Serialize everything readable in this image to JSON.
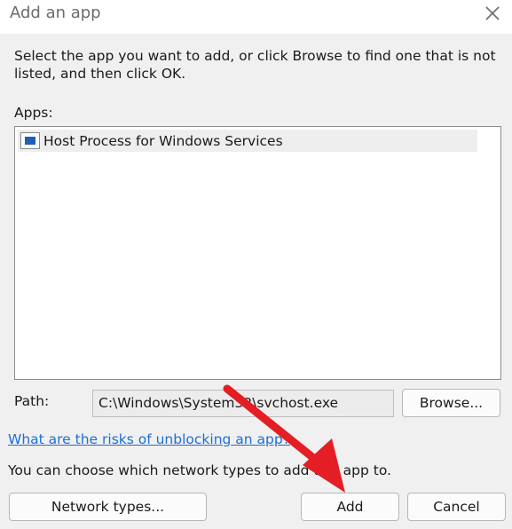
{
  "window": {
    "title": "Add an app",
    "close_icon": "close-icon"
  },
  "instructions": "Select the app you want to add, or click Browse to find one that is not listed, and then click OK.",
  "apps": {
    "label": "Apps:",
    "items": [
      {
        "name": "Host Process for Windows Services",
        "icon": "app-window-icon"
      }
    ]
  },
  "path": {
    "label": "Path:",
    "value": "C:\\Windows\\System32\\svchost.exe",
    "browse_label": "Browse..."
  },
  "risks_link": "What are the risks of unblocking an app?",
  "network_note": "You can choose which network types to add this app to.",
  "buttons": {
    "network_types": "Network types...",
    "add": "Add",
    "cancel": "Cancel"
  },
  "colors": {
    "link": "#1f6fd1",
    "annotation_arrow": "#e31e24"
  }
}
